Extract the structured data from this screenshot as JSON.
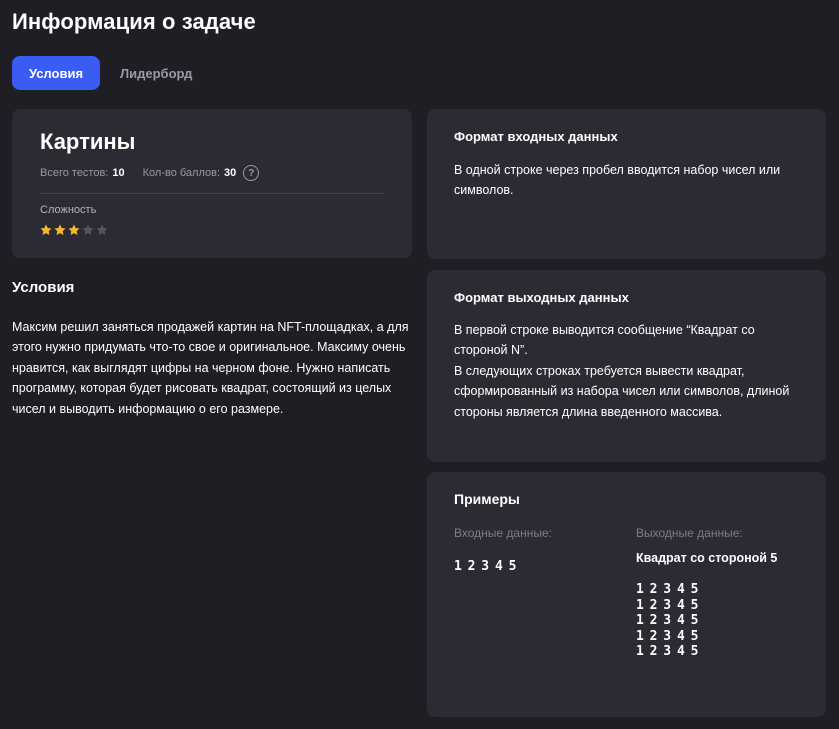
{
  "page": {
    "title": "Информация о задаче"
  },
  "tabs": [
    {
      "label": "Условия",
      "active": true
    },
    {
      "label": "Лидерборд",
      "active": false
    }
  ],
  "task": {
    "name": "Картины",
    "tests_label": "Всего тестов:",
    "tests_value": "10",
    "points_label": "Кол-во баллов:",
    "points_value": "30",
    "help_glyph": "?",
    "difficulty_label": "Сложность",
    "difficulty_rating": 3,
    "difficulty_max": 5,
    "star_color_filled": "#f5b82e",
    "star_color_empty": "#55555f"
  },
  "conditions": {
    "heading": "Условия",
    "text": "Максим решил заняться продажей картин на NFT-площадках, а для этого нужно придумать что-то свое и оригинальное. Максиму очень нравится, как выглядят цифры на черном фоне. Нужно написать программу, которая будет рисовать квадрат, состоящий из целых чисел и выводить информацию о его размере."
  },
  "input_format": {
    "heading": "Формат входных данных",
    "text": "В одной строке через пробел вводится набор чисел или символов."
  },
  "output_format": {
    "heading": "Формат выходных данных",
    "line1": "В первой строке выводится сообщение “Квадрат со стороной N”.",
    "line2": "В следующих строках требуется вывести квадрат, сформированный из набора чисел или символов, длиной стороны является длина введенного массива."
  },
  "examples": {
    "heading": "Примеры",
    "input_label": "Входные данные:",
    "output_label": "Выходные данные:",
    "input": "1 2 3 4 5",
    "output_title": "Квадрат со стороной 5",
    "output_lines": [
      "1 2 3 4 5",
      "1 2 3 4 5",
      "1 2 3 4 5",
      "1 2 3 4 5",
      "1 2 3 4 5"
    ]
  },
  "colors": {
    "background": "#1e1e24",
    "card": "#2b2b33",
    "accent": "#3a5cf2",
    "muted_text": "#9a9aa6"
  },
  "icons": {
    "help": "question-circle-icon",
    "star": "star-icon"
  }
}
